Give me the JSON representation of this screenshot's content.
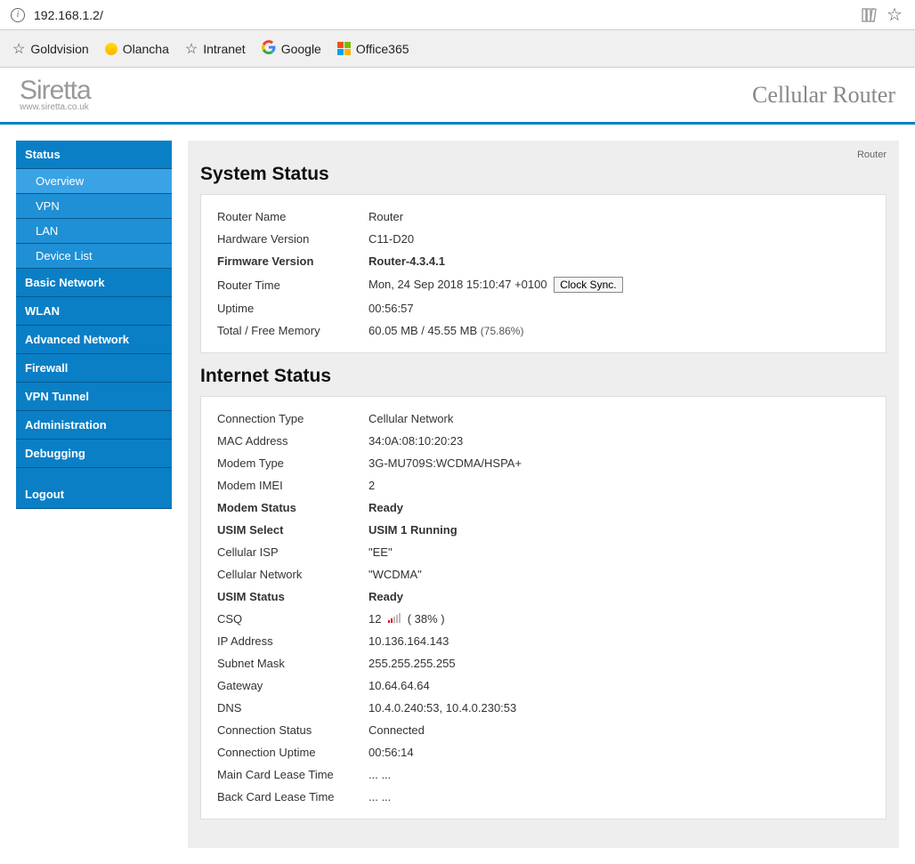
{
  "browser": {
    "url": "192.168.1.2/",
    "bookmarks": [
      "Goldvision",
      "Olancha",
      "Intranet",
      "Google",
      "Office365"
    ]
  },
  "brand": {
    "logo": "Siretta",
    "url": "www.siretta.co.uk",
    "product": "Cellular Router"
  },
  "sidebar": {
    "section_status": "Status",
    "sub_overview": "Overview",
    "sub_vpn": "VPN",
    "sub_lan": "LAN",
    "sub_devicelist": "Device List",
    "section_basic": "Basic Network",
    "section_wlan": "WLAN",
    "section_adv": "Advanced Network",
    "section_firewall": "Firewall",
    "section_vpntunnel": "VPN Tunnel",
    "section_admin": "Administration",
    "section_debug": "Debugging",
    "section_logout": "Logout"
  },
  "main": {
    "breadcrumb": "Router",
    "system_status_title": "System Status",
    "internet_status_title": "Internet Status",
    "clock_sync_btn": "Clock Sync.",
    "sys": {
      "router_name": {
        "l": "Router Name",
        "v": "Router"
      },
      "hw_ver": {
        "l": "Hardware Version",
        "v": "C11-D20"
      },
      "fw_ver": {
        "l": "Firmware Version",
        "v": "Router-4.3.4.1"
      },
      "router_time": {
        "l": "Router Time",
        "v": "Mon, 24 Sep 2018 15:10:47 +0100"
      },
      "uptime": {
        "l": "Uptime",
        "v": "00:56:57"
      },
      "mem": {
        "l": "Total / Free Memory",
        "v_total": "60.05 MB",
        "sep": " / ",
        "v_free": "45.55 MB",
        "pct": "(75.86%)"
      }
    },
    "net": {
      "conn_type": {
        "l": "Connection Type",
        "v": "Cellular Network"
      },
      "mac": {
        "l": "MAC Address",
        "v": "34:0A:08:10:20:23"
      },
      "modem_type": {
        "l": "Modem Type",
        "v": "3G-MU709S:WCDMA/HSPA+"
      },
      "modem_imei": {
        "l": "Modem IMEI",
        "v": "2"
      },
      "modem_status": {
        "l": "Modem Status",
        "v": "Ready"
      },
      "usim_select": {
        "l": "USIM Select",
        "v": "USIM 1 Running"
      },
      "isp": {
        "l": "Cellular ISP",
        "v": "\"EE\""
      },
      "network": {
        "l": "Cellular Network",
        "v": "\"WCDMA\""
      },
      "usim_status": {
        "l": "USIM Status",
        "v": "Ready"
      },
      "csq": {
        "l": "CSQ",
        "v_pre": "12",
        "v_post": "( 38% )"
      },
      "ip": {
        "l": "IP Address",
        "v": "10.136.164.143"
      },
      "mask": {
        "l": "Subnet Mask",
        "v": "255.255.255.255"
      },
      "gw": {
        "l": "Gateway",
        "v": "10.64.64.64"
      },
      "dns": {
        "l": "DNS",
        "v": "10.4.0.240:53, 10.4.0.230:53"
      },
      "conn_status": {
        "l": "Connection Status",
        "v": "Connected"
      },
      "conn_uptime": {
        "l": "Connection Uptime",
        "v": "00:56:14"
      },
      "lease_main": {
        "l": "Main Card Lease Time",
        "v": "... ..."
      },
      "lease_back": {
        "l": "Back Card Lease Time",
        "v": "... ..."
      }
    }
  }
}
